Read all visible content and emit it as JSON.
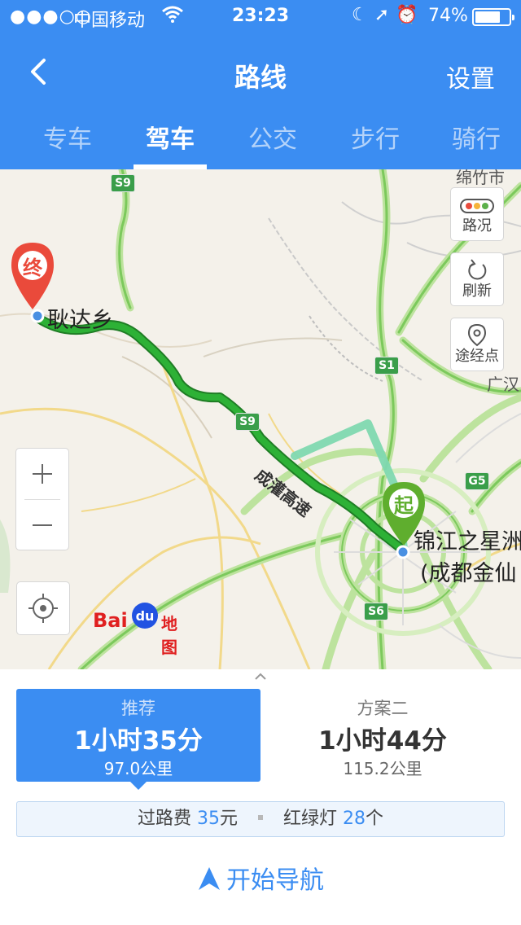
{
  "status_bar": {
    "signal": "●●●○○",
    "carrier": "中国移动",
    "time": "23:23",
    "battery_pct": "74%",
    "battery_level": 0.74,
    "icons": [
      "wifi-icon",
      "moon-icon",
      "location-arrow-icon",
      "alarm-icon",
      "battery-icon"
    ]
  },
  "header": {
    "title": "路线",
    "settings_label": "设置",
    "background": "#3b8df2"
  },
  "tabs": [
    {
      "label": "专车",
      "active": false
    },
    {
      "label": "驾车",
      "active": true
    },
    {
      "label": "公交",
      "active": false
    },
    {
      "label": "步行",
      "active": false
    },
    {
      "label": "骑行",
      "active": false
    }
  ],
  "map": {
    "start_marker": "起",
    "end_marker": "终",
    "end_place": "耿达乡",
    "start_place_line1": "锦江之星洲",
    "start_place_line2": "(成都金仙",
    "city_mianzhu": "绵竹市",
    "city_guanghan": "广汉",
    "highway_name": "成灌高速",
    "shields": [
      "S9",
      "S9",
      "S1",
      "G5",
      "S6"
    ],
    "controls": {
      "traffic_label": "路况",
      "refresh_label": "刷新",
      "waypoint_label": "途经点"
    },
    "logo": {
      "bai": "Bai",
      "du": "du",
      "ditu": "地图"
    },
    "route_color": "#2db136",
    "alt_route_color": "#7fd8b0"
  },
  "routes": [
    {
      "tag": "推荐",
      "duration": "1小时35分",
      "distance": "97.0公里",
      "selected": true
    },
    {
      "tag": "方案二",
      "duration": "1小时44分",
      "distance": "115.2公里",
      "selected": false
    }
  ],
  "info": {
    "toll_label": "过路费",
    "toll_value": "35",
    "toll_unit": "元",
    "lights_label": "红绿灯",
    "lights_value": "28",
    "lights_unit": "个"
  },
  "start_nav_label": "开始导航"
}
